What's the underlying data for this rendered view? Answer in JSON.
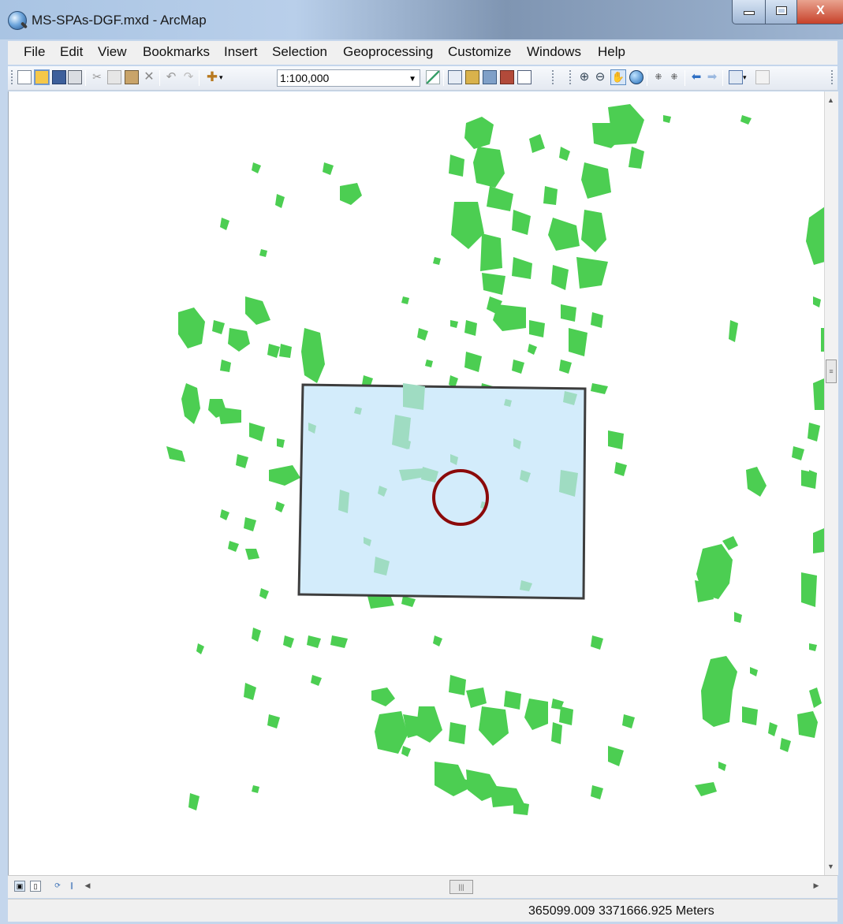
{
  "window": {
    "title": "MS-SPAs-DGF.mxd - ArcMap"
  },
  "menu": [
    "File",
    "Edit",
    "View",
    "Bookmarks",
    "Insert",
    "Selection",
    "Geoprocessing",
    "Customize",
    "Windows",
    "Help"
  ],
  "toolbar": {
    "scale": "1:100,000"
  },
  "colors": {
    "vegetation": "#4cce52",
    "extent_fill": "#d3ecfb",
    "extent_stroke": "#3d3d3d",
    "circle": "#8b0a0a"
  },
  "statusbar": {
    "coordinates": "365099.009  3371666.925 Meters"
  }
}
